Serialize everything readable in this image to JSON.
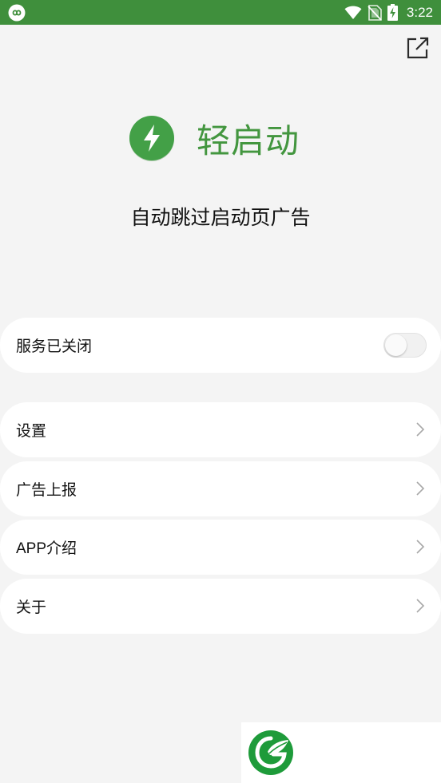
{
  "status_bar": {
    "time": "3:22"
  },
  "app": {
    "name": "轻启动",
    "tagline": "自动跳过启动页广告",
    "accent": "#43963f"
  },
  "service": {
    "label": "服务已关闭",
    "enabled": false
  },
  "menu": {
    "settings": "设置",
    "ad_report": "广告上报",
    "app_intro": "APP介绍",
    "about": "关于"
  },
  "icons": [
    "infinity-icon",
    "wifi-icon",
    "no-sim-icon",
    "battery-charging-icon",
    "share-icon",
    "lightning-bolt-icon",
    "chevron-right-icon",
    "leaf-logo-icon"
  ]
}
